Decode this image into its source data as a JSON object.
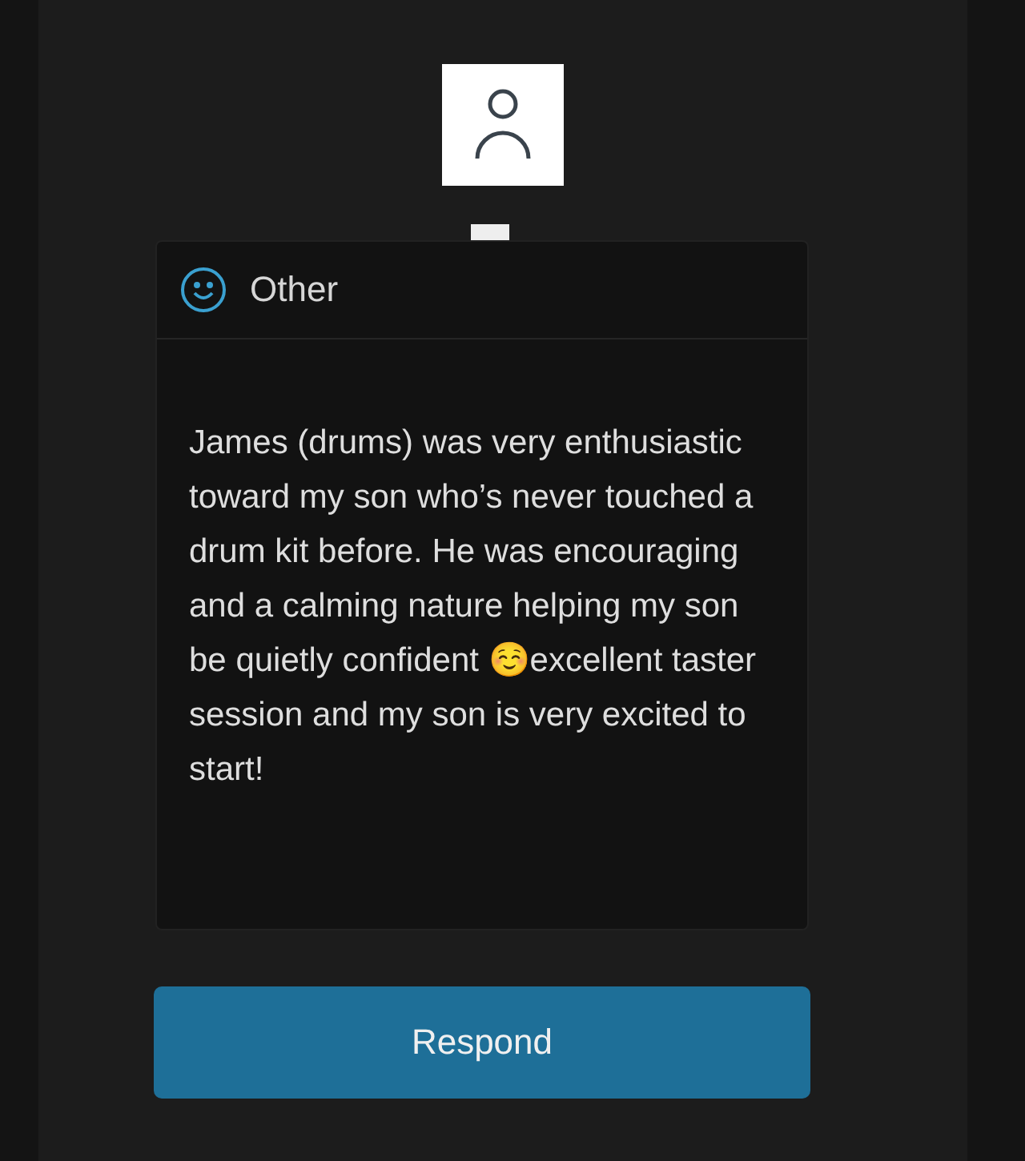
{
  "review": {
    "category": "Other",
    "text": "James (drums) was very enthusiastic toward my son who’s never touched a drum kit before. He was encouraging and a calming nature helping my son be quietly confident ☺️excellent taster session and my son is very excited to start!"
  },
  "buttons": [
    "Respond"
  ]
}
